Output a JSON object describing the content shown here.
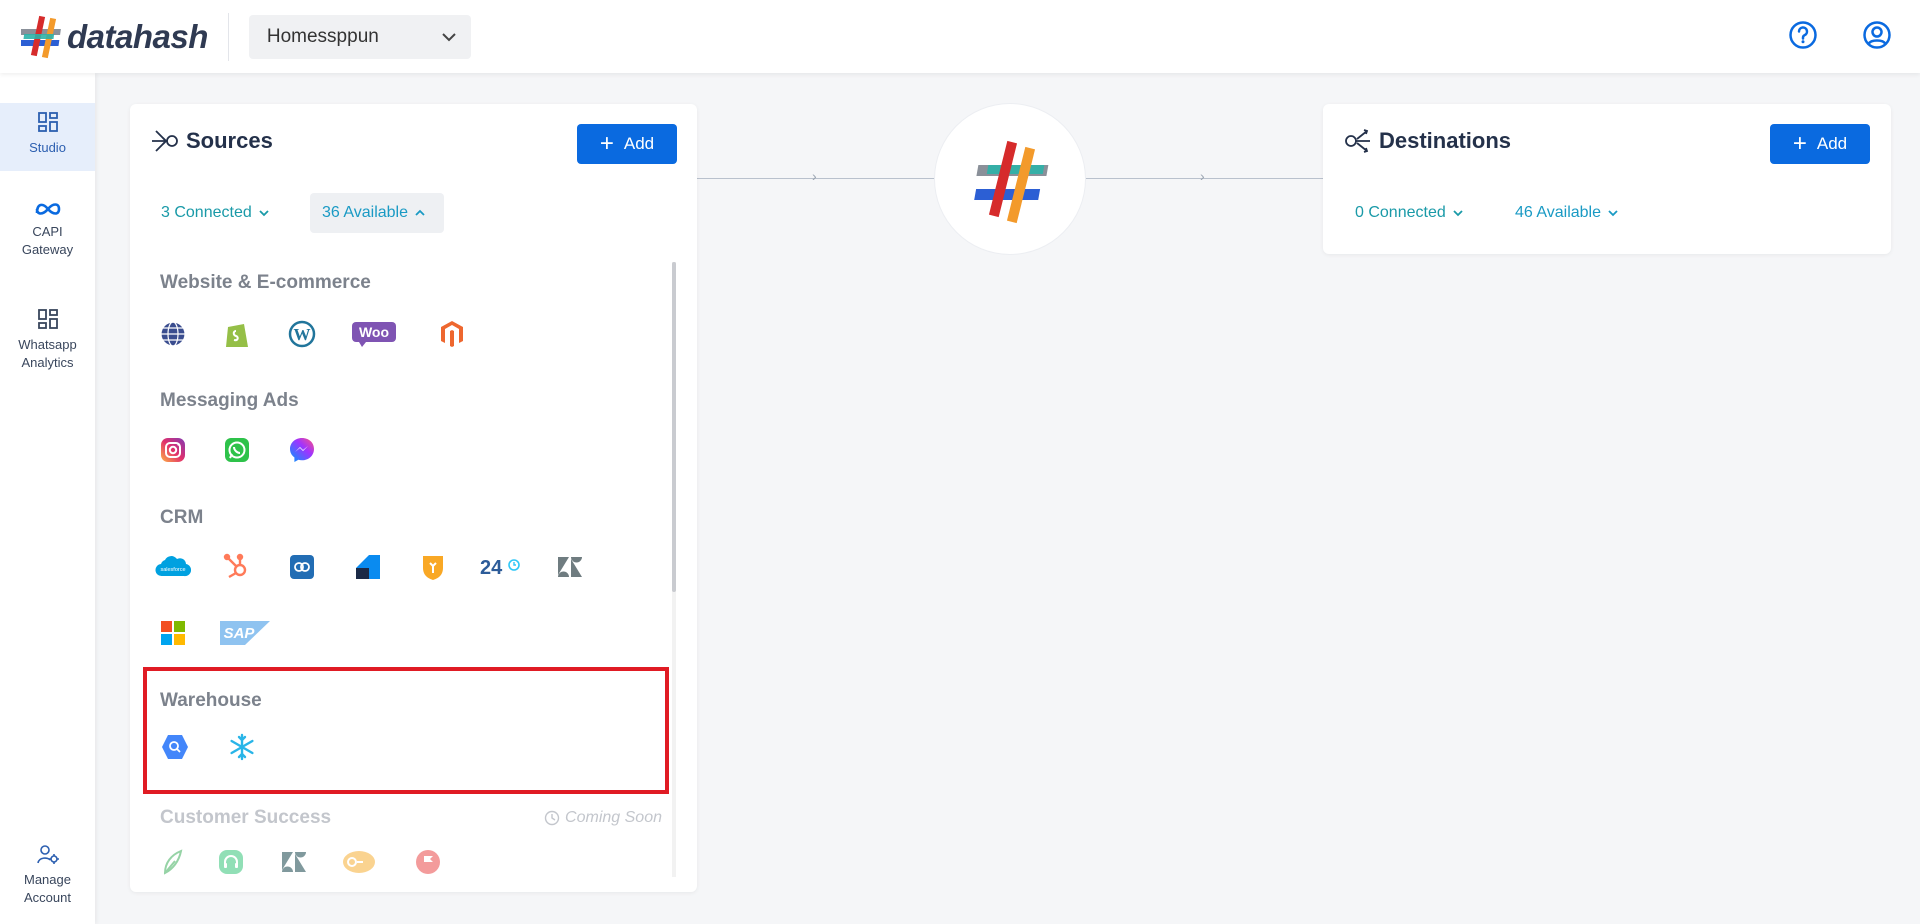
{
  "app": {
    "name": "datahash"
  },
  "header": {
    "project": "Homessppun"
  },
  "sidebar": {
    "items": [
      {
        "label": "Studio",
        "icon": "grid-icon"
      },
      {
        "label": "CAPI",
        "label2": "Gateway",
        "icon": "meta-icon"
      },
      {
        "label": "Whatsapp",
        "label2": "Analytics",
        "icon": "grid-icon"
      }
    ],
    "bottom": {
      "label": "Manage",
      "label2": "Account",
      "icon": "user-settings-icon"
    }
  },
  "sources": {
    "title": "Sources",
    "add_label": "Add",
    "connected": "3 Connected",
    "available": "36 Available",
    "sections": [
      {
        "title": "Website & E-commerce",
        "icons": [
          "globe-icon",
          "shopify-icon",
          "wordpress-icon",
          "woocommerce-icon",
          "magento-icon"
        ]
      },
      {
        "title": "Messaging Ads",
        "icons": [
          "instagram-icon",
          "whatsapp-icon",
          "messenger-icon"
        ]
      },
      {
        "title": "CRM",
        "icons": [
          "salesforce-icon",
          "hubspot-icon",
          "zoho-icon",
          "freshsales-icon",
          "pipedrive-icon",
          "bitrix24-icon",
          "zendesk-icon",
          "microsoft-icon",
          "sap-icon"
        ]
      },
      {
        "title": "Warehouse",
        "icons": [
          "bigquery-icon",
          "snowflake-icon"
        ]
      },
      {
        "title": "Customer Success",
        "badge": "Coming Soon",
        "icons": [
          "cs-leaf-icon",
          "cs-headset-icon",
          "zendesk-icon",
          "cs-chat-icon",
          "cs-flag-icon"
        ]
      }
    ]
  },
  "destinations": {
    "title": "Destinations",
    "add_label": "Add",
    "connected": "0 Connected",
    "available": "46 Available"
  },
  "colors": {
    "brand_blue": "#0a6ae0",
    "teal": "#1a9aa8",
    "highlight": "#e01b24"
  }
}
